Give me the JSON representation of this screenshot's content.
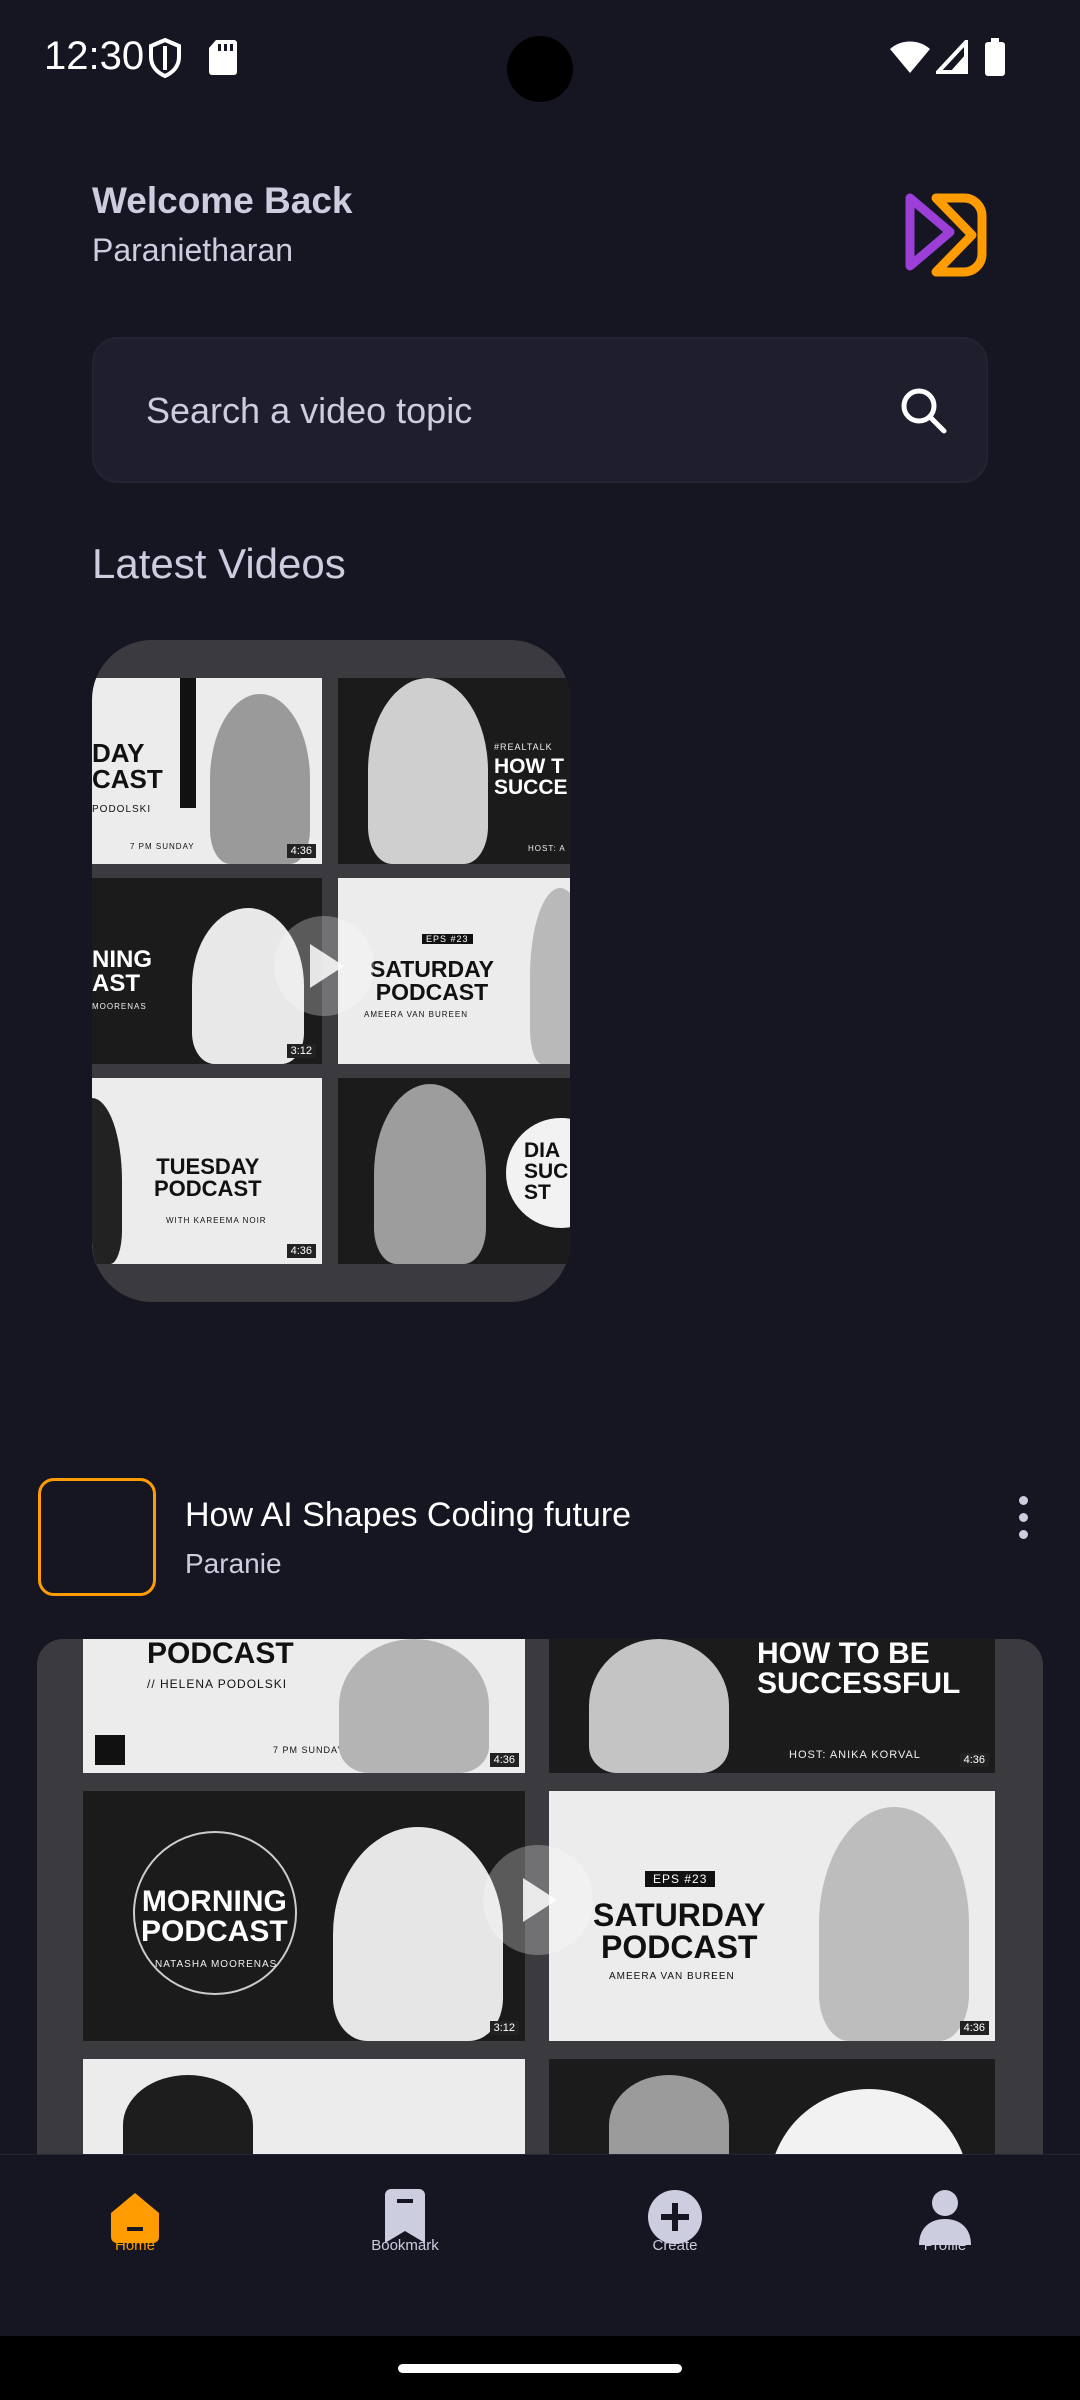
{
  "status_bar": {
    "time": "12:30"
  },
  "header": {
    "welcome": "Welcome Back",
    "username": "Paranietharan"
  },
  "search": {
    "placeholder": "Search a video topic"
  },
  "latest": {
    "title": "Latest Videos"
  },
  "thumb_tiles": {
    "t1": "DAY\nCAST",
    "t1sub": "PODOLSKI",
    "t1time": "7 PM SUNDAY",
    "t1dur": "4:36",
    "t2tag": "#REALTALK",
    "t2": "HOW T\nSUCCE",
    "t2host": "HOST: A",
    "t3": "NING\nAST",
    "t3sub": "MOORENAS",
    "t3dur": "3:12",
    "t4eps": "EPS #23",
    "t4": "SATURDAY\nPODCAST",
    "t4sub": "AMEERA VAN BUREEN",
    "t5": "TUESDAY\nPODCAST",
    "t5sub": "WITH KAREEMA NOIR",
    "t5dur": "4:36",
    "t6": "DIA\nSUC\nST"
  },
  "video": {
    "title": "How AI Shapes Coding future",
    "author": "Paranie"
  },
  "big_tiles": {
    "b1": "PODCAST",
    "b1sub": "// HELENA PODOLSKI",
    "b1time": "7 PM SUNDAY",
    "b1dur": "4:36",
    "b2": "HOW TO BE\nSUCCESSFUL",
    "b2host": "HOST: ANIKA KORVAL",
    "b2dur": "4:36",
    "b3": "MORNING\nPODCAST",
    "b3sub": "NATASHA MOORENAS",
    "b3dur": "3:12",
    "b4eps": "EPS #23",
    "b4": "SATURDAY\nPODCAST",
    "b4sub": "AMEERA VAN BUREEN",
    "b4dur": "4:36"
  },
  "tabs": [
    {
      "label": "Home",
      "icon": "home-icon",
      "active": true
    },
    {
      "label": "Bookmark",
      "icon": "bookmark-icon",
      "active": false
    },
    {
      "label": "Create",
      "icon": "plus-circle-icon",
      "active": false
    },
    {
      "label": "Profile",
      "icon": "profile-icon",
      "active": false
    }
  ],
  "colors": {
    "accent": "#ff9c01",
    "background": "#161622",
    "surface": "#1e1e2d",
    "logo_purple": "#9b3fd8"
  }
}
